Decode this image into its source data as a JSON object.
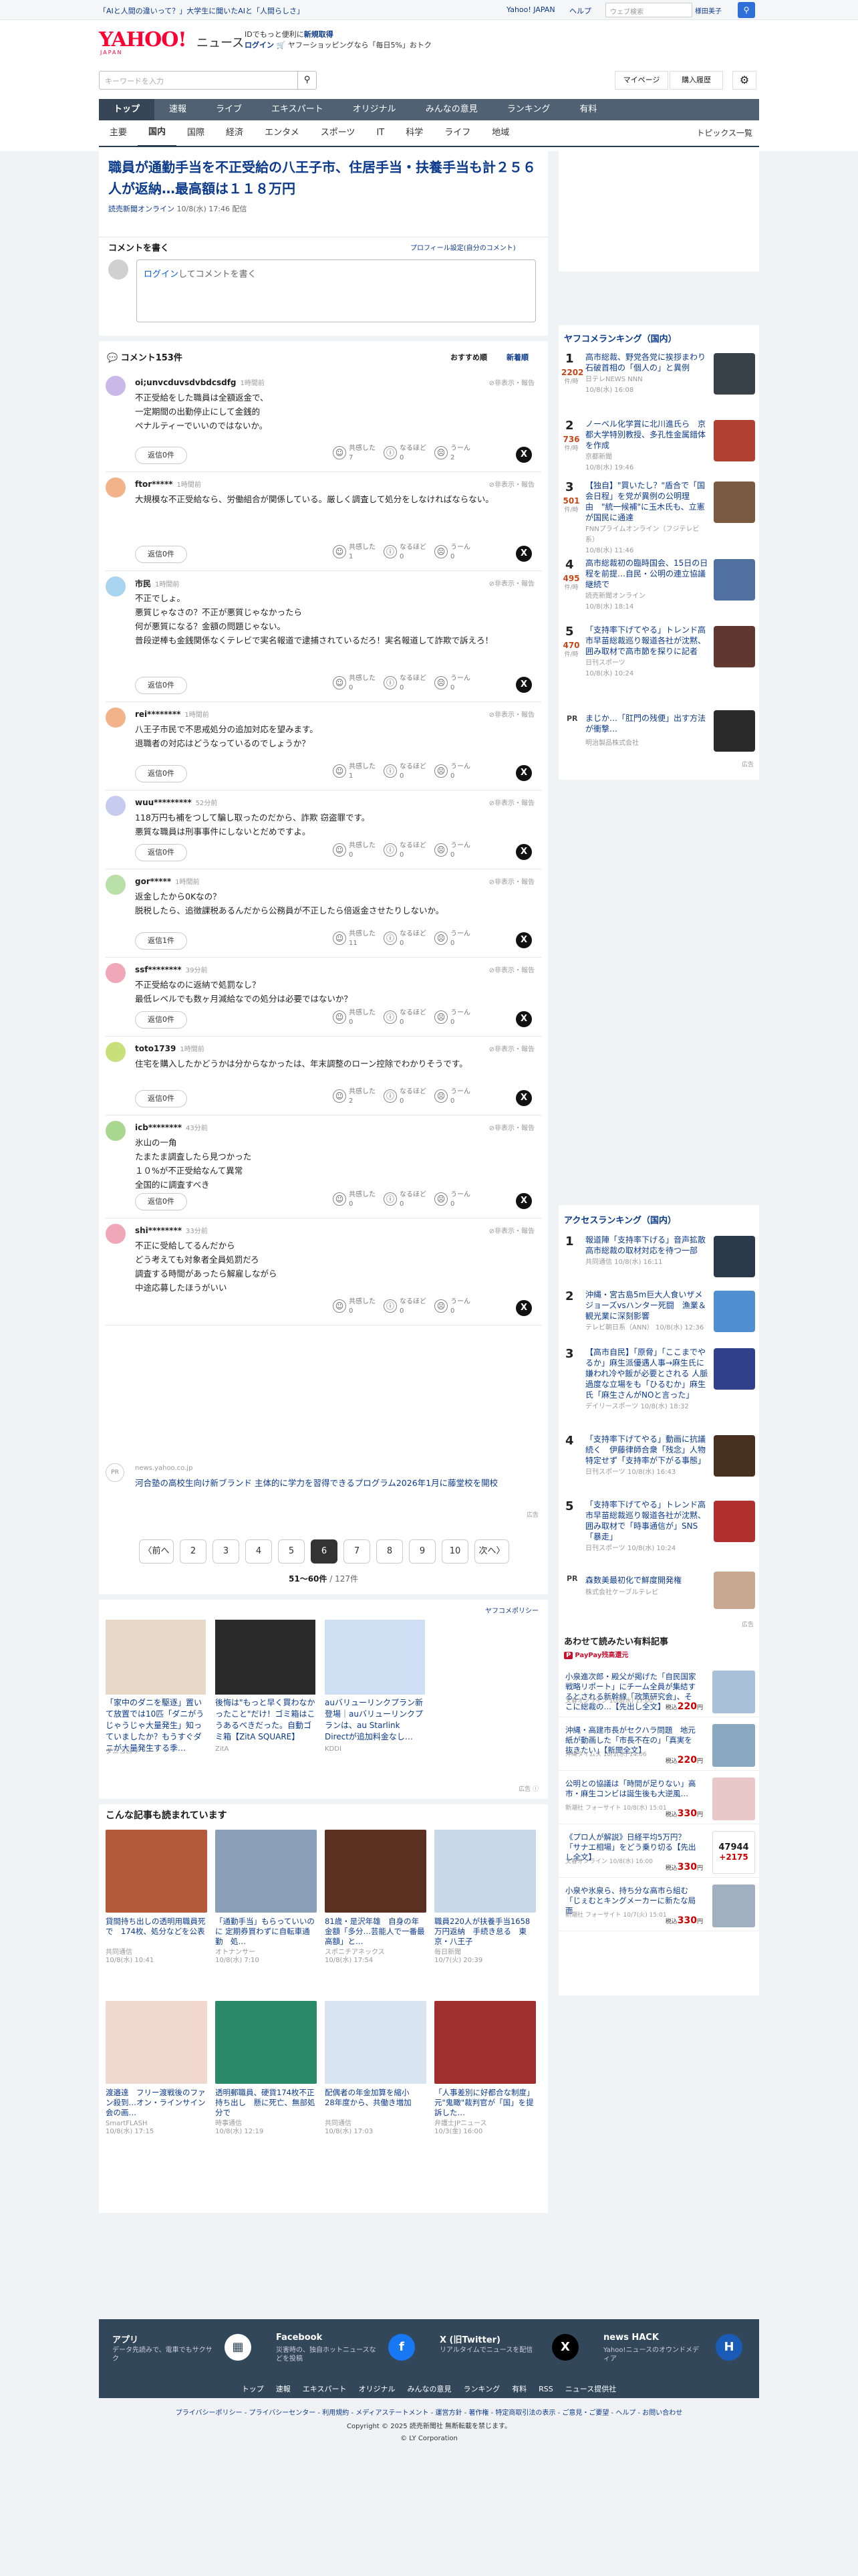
{
  "topbar": {
    "promo_left": "「AIと人間の違いって？」大学生に聞いたAIと「人間らしさ」",
    "links": [
      "Yahoo! JAPAN",
      "ヘルプ"
    ],
    "search_placeholder": "ウェブ検索",
    "user": "様田美子",
    "search_icon": "search-icon"
  },
  "header": {
    "logo_main": "YAHOO!",
    "logo_sub": "JAPAN",
    "logo_news": "ニュース",
    "id_promo_1": "IDでもっと便利に",
    "id_promo_link": "新規取得",
    "login_label": "ログイン",
    "id_promo_2": "ヤフーショッピングなら「毎日5%」おトク",
    "search_placeholder": "キーワードを入力",
    "mypage": "マイページ",
    "history": "購入履歴",
    "gear_icon": "gear-icon"
  },
  "nav1": [
    "トップ",
    "速報",
    "ライブ",
    "エキスパート",
    "オリジナル",
    "みんなの意見",
    "ランキング",
    "有料"
  ],
  "nav2": [
    "主要",
    "国内",
    "国際",
    "経済",
    "エンタメ",
    "スポーツ",
    "IT",
    "科学",
    "ライフ",
    "地域"
  ],
  "nav2_right": "トピックス一覧",
  "article": {
    "title": "職員が通勤手当を不正受給の八王子市、住居手当・扶養手当も計２５６人が返納…最高額は１１８万円",
    "source": "読売新聞オンライン",
    "date": "10/8(水) 17:46 配信"
  },
  "comment_form": {
    "heading": "コメントを書く",
    "profile_link": "プロフィール設定(自分のコメント)",
    "login_link": "ログイン",
    "placeholder_suffix": "してコメントを書く"
  },
  "comments_header": {
    "count_label": "コメント153件",
    "sort_recommend": "おすすめ順",
    "sort_new": "新着順"
  },
  "reaction_labels": [
    "共感した",
    "なるほど",
    "うーん"
  ],
  "hide_label": "非表示・報告",
  "comments": [
    {
      "name": "oi;unvcduvsdvbdcsdfg",
      "time": "1時間前",
      "body": "不正受給をした職員は全額返金で、\n一定期間の出勤停止にして金銭的\nペナルティーでいいのではないか。",
      "replies": "返信0件",
      "counts": [
        "7",
        "0",
        "2"
      ],
      "color": "#c9b8e8"
    },
    {
      "name": "ftor*****",
      "time": "1時間前",
      "body": "大規模な不正受給なら、労働組合が関係している。厳しく調査して処分をしなければならない。",
      "replies": "返信0件",
      "counts": [
        "1",
        "0",
        "0"
      ],
      "color": "#f2b38a"
    },
    {
      "name": "市民",
      "time": "1時間前",
      "body": "不正でしょ。\n悪質じゃなさの？不正が悪質じゃなかったら\n何が悪質になる？金額の問題じゃない。\n普段逆棒も金銭関係なくテレビで実名報道で逮捕されているだろ！実名報道して詐欺で訴えろ！",
      "replies": "返信0件",
      "counts": [
        "0",
        "0",
        "0"
      ],
      "color": "#a8d4f0"
    },
    {
      "name": "rei********",
      "time": "1時間前",
      "body": "八王子市民で不思戒処分の追加対応を望みます。\n退職者の対応はどうなっているのでしょうか？",
      "replies": "返信0件",
      "counts": [
        "1",
        "0",
        "0"
      ],
      "color": "#f2b38a"
    },
    {
      "name": "wuu*********",
      "time": "52分前",
      "body": "118万円も補をつして騙し取ったのだから、詐欺 窃盗罪です。\n悪質な職員は刑事事件にしないとだめですよ。",
      "replies": "返信0件",
      "counts": [
        "0",
        "0",
        "0"
      ],
      "color": "#c6cbf0"
    },
    {
      "name": "gor*****",
      "time": "1時間前",
      "body": "返金したから0Kなの？\n脱税したら、追徴課税あるんだから公務員が不正したら倍返金させたりしないか。",
      "replies": "返信1件",
      "counts": [
        "11",
        "0",
        "0"
      ],
      "color": "#b8e0a8"
    },
    {
      "name": "ssf********",
      "time": "39分前",
      "body": "不正受給なのに返納で処罰なし？\n最低レベルでも数ヶ月減給なでの処分は必要ではないか？",
      "replies": "返信0件",
      "counts": [
        "0",
        "0",
        "0"
      ],
      "color": "#f0a8b8"
    },
    {
      "name": "toto1739",
      "time": "1時間前",
      "body": "住宅を購入したかどうかは分からなかったは、年末調整のローン控除でわかりそうです。",
      "replies": "返信0件",
      "counts": [
        "2",
        "0",
        "0"
      ],
      "color": "#c8e07a"
    },
    {
      "name": "icb********",
      "time": "43分前",
      "body": "氷山の一角\nたまたま調査したら見つかった\n１０%が不正受給なんて異常\n全国的に調査すべき",
      "replies": "返信0件",
      "counts": [
        "0",
        "0",
        "0"
      ],
      "color": "#a8d890"
    },
    {
      "name": "shi********",
      "time": "33分前",
      "body": "不正に受給してるんだから\nどう考えても対象者全員処罰だろ\n調査する時間があったら解雇しながら\n中途応募したほうがいい",
      "replies": "",
      "counts": [
        "0",
        "0",
        "0"
      ],
      "color": "#f0a8b8"
    }
  ],
  "sponsored": {
    "pr": "PR",
    "domain": "news.yahoo.co.jp",
    "text": "河合塾の高校生向け新ブランド 主体的に学力を習得できるプログラム2026年1月に藤堂校を開校",
    "ad_label": "広告"
  },
  "pagination": {
    "prev": "〈前へ",
    "next": "次へ〉",
    "pages": [
      "2",
      "3",
      "4",
      "5",
      "6",
      "7",
      "8",
      "9",
      "10"
    ],
    "current": "6",
    "range": "51〜60件",
    "total": "/ 127件"
  },
  "policy_link": "ヤフコメポリシー",
  "ads3": [
    {
      "text": "「家中のダニを駆逐」置いて放置では10匹「ダニがうじゃうじゃ大量発生」知っていましたか？もうすぐダニが大量発生する季…",
      "src": "ダニコロリ",
      "color": "#e8d8c8"
    },
    {
      "text": "後悔は\"もっと早く買わなかったこと\"だけ！ゴミ箱はこうあるべきだった。自動ゴミ箱【ZitA SQUARE】",
      "src": "ZitA",
      "color": "#2a2a2a"
    },
    {
      "text": "auバリューリンクプラン新登場｜auバリューリンクプランは、au Starlink Directが追加料金なし…",
      "src": "KDDI",
      "color": "#cfe0f5"
    }
  ],
  "readnext": {
    "heading": "こんな記事も読まれています",
    "cards": [
      {
        "title": "貸間持ち出しの透明用職員死で　174枚、処分などを公表",
        "src": "共同通信",
        "time": "10/8(水) 10:41",
        "color": "#b45a3a"
      },
      {
        "title": "「通勤手当」もらっていいのに 定期券買わずに自転車通勤　処…",
        "src": "オトナンサー",
        "time": "10/8(水) 7:10",
        "color": "#8aa0b8"
      },
      {
        "title": "81歳・是沢年雄　自身の年金額「多分…芸能人で一番最高額」と…",
        "src": "スポニチアネックス",
        "time": "10/8(水) 17:54",
        "color": "#5a3020"
      },
      {
        "title": "職員220人が扶養手当1658万円返納　手続き怠る　東京・八王子",
        "src": "毎日新聞",
        "time": "10/7(火) 20:39",
        "color": "#c8d8e8"
      },
      {
        "title": "渡邉達　フリー渡戦後のファン殺到…オン・ラインサイン会の画…",
        "src": "SmartFLASH",
        "time": "10/8(水) 17:15",
        "color": "#f0d8d0"
      },
      {
        "title": "透明郵職員、硬貨174枚不正持ち出し　懸に死亡、無部処分で",
        "src": "時事通信",
        "time": "10/8(水) 12:19",
        "color": "#2a8a6a"
      },
      {
        "title": "配偶者の年金加算を縮小　28年度から、共働き増加",
        "src": "共同通信",
        "time": "10/8(水) 17:03",
        "color": "#d8e4f0"
      },
      {
        "title": "「人事差別に好都合な制度」元\"鬼瞰\"裁判官が「国」を提訴した…",
        "src": "弁護士JPニュース",
        "time": "10/3(金) 16:00",
        "color": "#a03030"
      }
    ]
  },
  "ranking": {
    "heading": "ヤフコメランキング（国内）",
    "unit": "件/時",
    "items": [
      {
        "no": "1",
        "count": "2202",
        "title": "高市総裁、野党各党に挨拶まわり　石破首相の「個人の」と異例",
        "src": "日テレNEWS NNN",
        "time": "10/8(水) 16:08",
        "color": "#38404a"
      },
      {
        "no": "2",
        "count": "736",
        "title": "ノーベル化学賞に北川進氏ら　京都大学特別教授、多孔性金属錯体を作成",
        "src": "京都新聞",
        "time": "10/8(水) 19:46",
        "color": "#b04030"
      },
      {
        "no": "3",
        "count": "501",
        "title": "【独自】\"買いたし？\"盾合で「国会日程」を党が異例の公明理由　\"統一候補\"に玉木氏も、立憲が国民に通達",
        "src": "FNNプライムオンライン（フジテレビ系）",
        "time": "10/8(水) 11:46",
        "color": "#7a5a40"
      },
      {
        "no": "4",
        "count": "495",
        "title": "高市総裁初の臨時国会、15日の日程を前提…自民・公明の連立協議継続で",
        "src": "読売新聞オンライン",
        "time": "10/8(水) 18:14",
        "color": "#5070a0"
      },
      {
        "no": "5",
        "count": "470",
        "title": "「支持率下げてやる」トレンド高市早苗総裁巡り報道各社が沈黙、囲み取材で高市節を探りに記者",
        "src": "日刊スポーツ",
        "time": "10/8(水) 10:24",
        "color": "#603830"
      }
    ],
    "pr_label": "PR",
    "pr_title": "まじか…「肛門の残便」出す方法が衝撃…",
    "pr_src": "明治製品株式会社",
    "ad_label": "広告"
  },
  "access": {
    "heading": "アクセスランキング（国内）",
    "items": [
      {
        "no": "1",
        "title": "報道陣「支持率下げる」音声拡散 高市総裁の取材対応を待つ一部",
        "src": "共同通信",
        "time": "10/8(水) 16:11",
        "color": "#2a3a4a"
      },
      {
        "no": "2",
        "title": "沖縄・宮古島5m巨大人食いザメ　ジョーズvsハンター死闘　漁業＆観光業に深刻影響",
        "src": "テレビ朝日系（ANN）",
        "time": "10/8(水) 12:36",
        "color": "#5090d0"
      },
      {
        "no": "3",
        "title": "【高市自民】「原脅」「ここまでやるか」麻生派優遇人事→麻生氏に嫌われ冷や飯が必要とされる 人脈　過度な立場をも「ひるむか」麻生氏「麻生さんがNOと言った」",
        "src": "デイリースポーツ",
        "time": "10/8(水) 18:32",
        "color": "#30408a"
      },
      {
        "no": "4",
        "title": "「支持率下げてやる」動画に抗議続く　伊藤律師合衆「残念」人物特定せず「支持率が下がる事態」",
        "src": "日刊スポーツ",
        "time": "10/8(水) 16:43",
        "color": "#483020"
      },
      {
        "no": "5",
        "title": "「支持率下げてやる」トレンド高市早苗総裁巡り報道各社が沈黙、囲み取材で「時事通信が」SNS「暴走」",
        "src": "日刊スポーツ",
        "time": "10/8(水) 10:24",
        "color": "#b03030"
      }
    ],
    "pr_label": "PR",
    "pr_title": "森数美最初化で鮮度開発権",
    "pr_src": "株式会社ケーブルテレビ",
    "ad_label": "広告"
  },
  "paid": {
    "heading": "あわせて読みたい有料記事",
    "badge": "PayPay残高還元",
    "items": [
      {
        "title": "小泉進次郎・殿父が掲げた「自民国家戦略リポート」にチーム全員が集結するとされる新幹線「政策研究会」、そこに総裁の…【先出し全文】",
        "src": "文春オンライン",
        "time": "10/8(水) 17:00",
        "price": "220",
        "color": "#a8c0d8"
      },
      {
        "title": "沖縄・高建市長がセクハラ問題　地元紙が動画した「市長不在の」「真実を抜きたい」【新聞全文】",
        "src": "沖縄タイムス",
        "time": "10/1(水) 14:06",
        "price": "220",
        "color": "#8aa8c0"
      },
      {
        "title": "公明との協議は「時間が足りない」高市・麻生コンビは誕生後も大逆風…",
        "src": "新潮社 フォーサイト",
        "time": "10/8(水) 15:01",
        "price": "330",
        "color": "#e8c8c8"
      },
      {
        "title": "《プロ人が解説》日経平均5万円？「サナエ相場」をどう乗り切る【先出し全文】",
        "src": "文春オンライン",
        "time": "10/8(水) 16:00",
        "price": "330",
        "stock": "47944",
        "delta": "+2175",
        "color": "#d0d0d0"
      },
      {
        "title": "小泉や氷泉ら、持ち分な高市ら組む「じぇむとキングメーカーに新たな局面",
        "src": "新潮社 フォーサイト",
        "time": "10/7(火) 15:01",
        "price": "330",
        "color": "#a0b0c0"
      }
    ],
    "tax": "税込",
    "yen": "円"
  },
  "footer": {
    "cols": [
      {
        "h": "アプリ",
        "d": "データ先読みで、電車でもサクサク",
        "icon": "app-icon"
      },
      {
        "h": "Facebook",
        "d": "災害時の、独自ホットニュースなどを投稿",
        "icon": "f"
      },
      {
        "h": "X (旧Twitter)",
        "d": "リアルタイムでニュースを配信",
        "icon": "X"
      },
      {
        "h": "news HACK",
        "d": "Yahoo!ニュースのオウンドメディア",
        "icon": "HACK"
      }
    ],
    "links": [
      "トップ",
      "速報",
      "エキスパート",
      "オリジナル",
      "みんなの意見",
      "ランキング",
      "有料",
      "RSS",
      "ニュース提供社"
    ],
    "legal": "プライバシーポリシー - プライバシーセンター - 利用規約 - メディアステートメント - 運営方針 - 著作権 - 特定商取引法の表示 - ご意見・ご要望 - ヘルプ - お問い合わせ",
    "copyright1": "Copyright © 2025 読売新聞社 無断転載を禁じます。",
    "copyright2": "© LY Corporation"
  }
}
